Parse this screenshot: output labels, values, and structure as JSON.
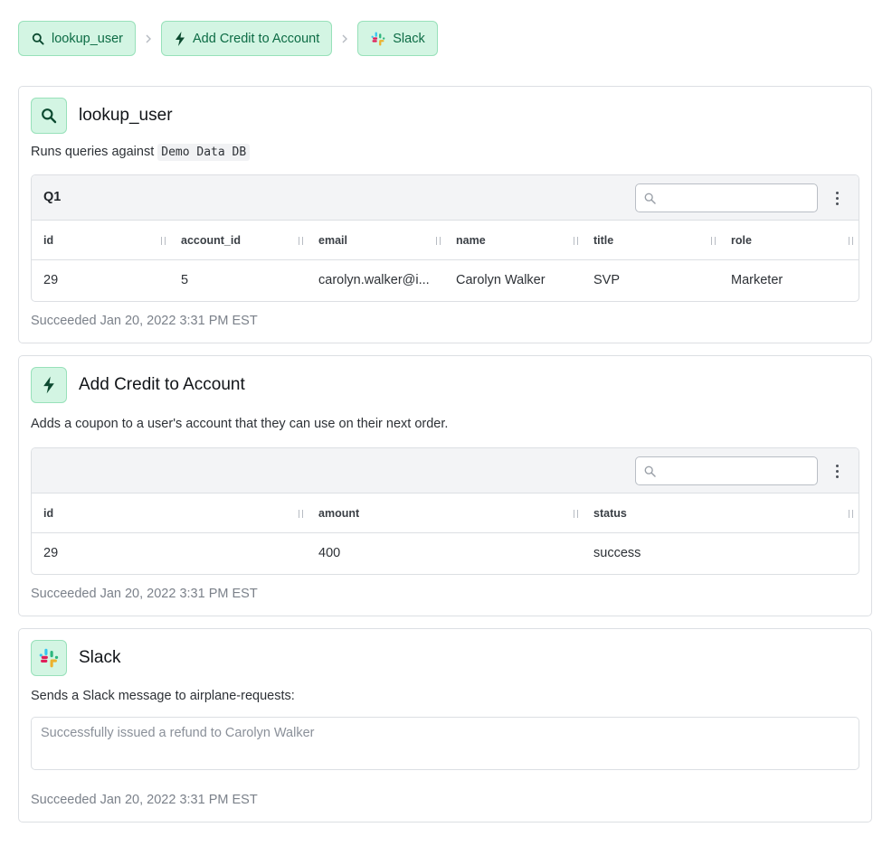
{
  "breadcrumb": [
    {
      "label": "lookup_user",
      "icon": "search-icon"
    },
    {
      "label": "Add Credit to Account",
      "icon": "lightning-icon"
    },
    {
      "label": "Slack",
      "icon": "slack-logo-icon"
    }
  ],
  "steps": {
    "lookup_user": {
      "title": "lookup_user",
      "description_prefix": "Runs queries against",
      "resource": "Demo Data DB",
      "table": {
        "name": "Q1",
        "search_placeholder": "",
        "columns": [
          "id",
          "account_id",
          "email",
          "name",
          "title",
          "role"
        ],
        "rows": [
          [
            "29",
            "5",
            "carolyn.walker@i...",
            "Carolyn Walker",
            "SVP",
            "Marketer"
          ]
        ]
      },
      "status": "Succeeded Jan 20, 2022 3:31 PM EST"
    },
    "add_credit": {
      "title": "Add Credit to Account",
      "description": "Adds a coupon to a user's account that they can use on their next order.",
      "table": {
        "name": "",
        "search_placeholder": "",
        "columns": [
          "id",
          "amount",
          "status"
        ],
        "rows": [
          [
            "29",
            "400",
            "success"
          ]
        ]
      },
      "status": "Succeeded Jan 20, 2022 3:31 PM EST"
    },
    "slack": {
      "title": "Slack",
      "description": "Sends a Slack message to airplane-requests:",
      "message": "Successfully issued a refund to Carolyn Walker",
      "status": "Succeeded Jan 20, 2022 3:31 PM EST"
    }
  },
  "colors": {
    "accent_bg": "#d3f5e3",
    "accent_border": "#98e1ba",
    "accent_text": "#0c6b44",
    "slack_red": "#E01E5A",
    "slack_blue": "#36C5F0",
    "slack_green": "#2EB67D",
    "slack_yellow": "#ECB22E"
  }
}
